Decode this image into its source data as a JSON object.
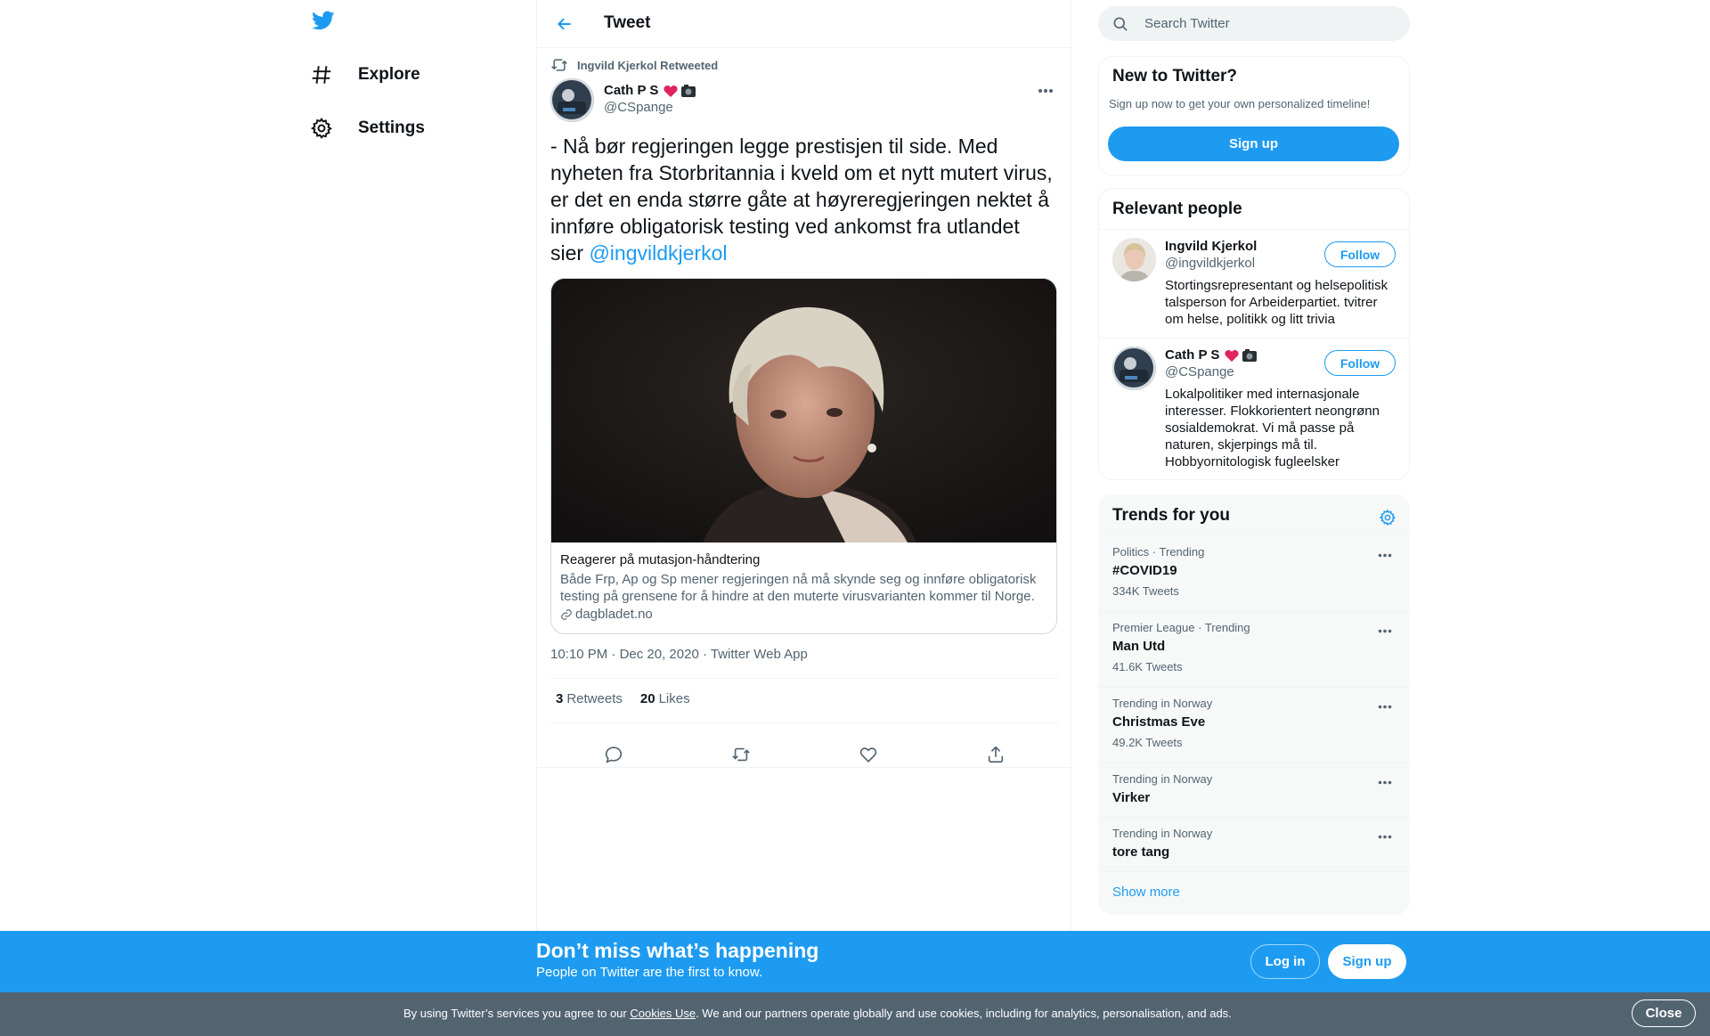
{
  "nav": {
    "logo_icon": "twitter-bird-icon",
    "items": [
      {
        "label": "Explore",
        "icon": "hashtag-icon"
      },
      {
        "label": "Settings",
        "icon": "gear-icon"
      }
    ]
  },
  "header": {
    "title": "Tweet",
    "back_icon": "arrow-left-icon"
  },
  "tweet": {
    "retweet_context": "Ingvild Kjerkol Retweeted",
    "author_name": "Cath P S",
    "author_emoji": "❤️📷",
    "author_handle": "@CSpange",
    "text_before_mention": "- Nå bør regjeringen legge prestisjen til side. Med nyheten fra Storbritannia i kveld om et nytt mutert virus, er det en enda større gåte at høyreregjeringen nektet å innføre obligatorisk testing ved ankomst fra utlandet sier ",
    "mention": "@ingvildkjerkol",
    "card": {
      "title": "Reagerer på mutasjon-håndtering",
      "description": "Både Frp, Ap og Sp mener regjeringen nå må skynde seg og innføre obligatorisk testing på grensene for å hindre at den muterte virusvarianten kommer til Norge.",
      "domain": "dagbladet.no"
    },
    "time": "10:10 PM",
    "date": "Dec 20, 2020",
    "source": "Twitter Web App",
    "meta_sep": "·",
    "retweets_count": "3",
    "retweets_label": "Retweets",
    "likes_count": "20",
    "likes_label": "Likes"
  },
  "search": {
    "placeholder": "Search Twitter"
  },
  "signup_panel": {
    "title": "New to Twitter?",
    "subtitle": "Sign up now to get your own personalized timeline!",
    "button": "Sign up"
  },
  "relevant_people": {
    "title": "Relevant people",
    "people": [
      {
        "name": "Ingvild Kjerkol",
        "handle": "@ingvildkjerkol",
        "bio": "Stortingsrepresentant og helsepolitisk talsperson for Arbeiderpartiet. tvitrer om helse, politikk og litt trivia",
        "follow": "Follow"
      },
      {
        "name": "Cath P S",
        "emoji": "❤️📷",
        "handle": "@CSpange",
        "bio": "Lokalpolitiker med internasjonale interesser. Flokkorientert neongrønn sosialdemokrat. Vi må passe på naturen, skjerpings må til. Hobbyornitologisk fugleelsker",
        "follow": "Follow"
      }
    ]
  },
  "trends": {
    "title": "Trends for you",
    "items": [
      {
        "context": "Politics · Trending",
        "name": "#COVID19",
        "count": "334K Tweets"
      },
      {
        "context": "Premier League · Trending",
        "name": "Man Utd",
        "count": "41.6K Tweets"
      },
      {
        "context": "Trending in Norway",
        "name": "Christmas Eve",
        "count": "49.2K Tweets"
      },
      {
        "context": "Trending in Norway",
        "name": "Virker",
        "count": ""
      },
      {
        "context": "Trending in Norway",
        "name": "tore tang",
        "count": ""
      }
    ],
    "show_more": "Show more"
  },
  "banner": {
    "title": "Don’t miss what’s happening",
    "subtitle": "People on Twitter are the first to know.",
    "login": "Log in",
    "signup": "Sign up"
  },
  "cookie": {
    "text_before": "By using Twitter’s services you agree to our ",
    "link": "Cookies Use",
    "text_after": ". We and our partners operate globally and use cookies, including for analytics, personalisation, and ads.",
    "close": "Close"
  },
  "colors": {
    "accent": "#1d9bf0",
    "banner": "#1d9bf0",
    "cookie_bar": "#536471",
    "muted_text": "#536471"
  }
}
